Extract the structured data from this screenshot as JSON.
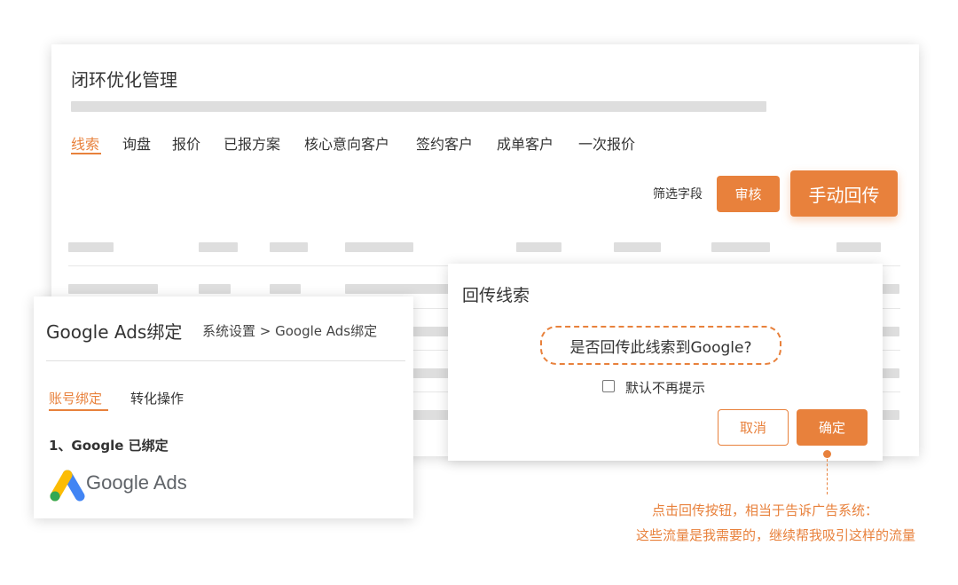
{
  "main": {
    "title": "闭环优化管理",
    "tabs": [
      {
        "label": "线索",
        "active": true
      },
      {
        "label": "询盘"
      },
      {
        "label": "报价"
      },
      {
        "label": "已报方案"
      },
      {
        "label": "核心意向客户"
      },
      {
        "label": "签约客户"
      },
      {
        "label": "成单客户"
      },
      {
        "label": "一次报价"
      }
    ],
    "filter_label": "筛选字段",
    "review_button": "审核",
    "manual_button": "手动回传"
  },
  "google_panel": {
    "title": "Google Ads绑定",
    "breadcrumb": "系统设置 > Google Ads绑定",
    "tabs": [
      {
        "label": "账号绑定",
        "active": true
      },
      {
        "label": "转化操作"
      }
    ],
    "status": "1、Google 已绑定",
    "logo_text": "Google Ads"
  },
  "dialog": {
    "title": "回传线索",
    "question": "是否回传此线索到Google?",
    "checkbox_label": "默认不再提示",
    "cancel": "取消",
    "confirm": "确定"
  },
  "annotation": {
    "line1": "点击回传按钮，相当于告诉广告系统：",
    "line2": "这些流量是我需要的，继续帮我吸引这样的流量"
  },
  "colors": {
    "accent": "#e8813c",
    "text": "#333333",
    "placeholder_bar": "#dedede"
  }
}
